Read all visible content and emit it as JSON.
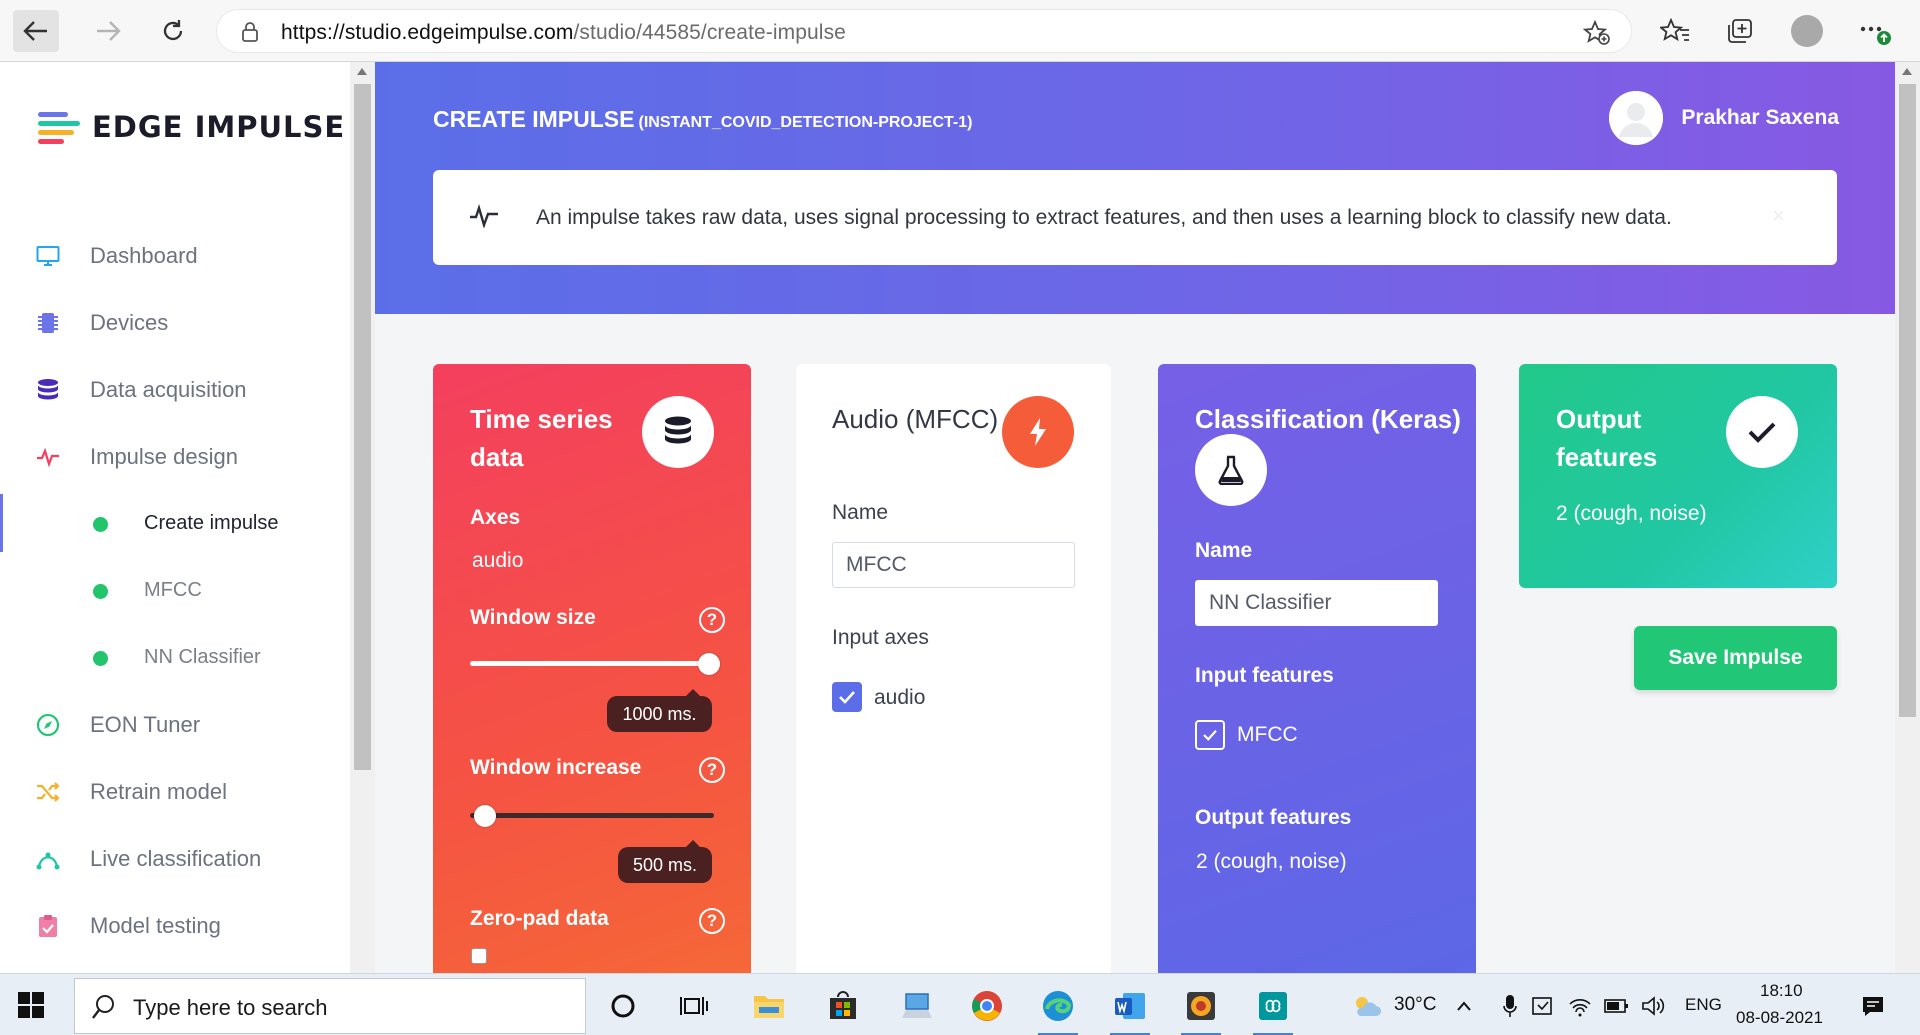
{
  "browser": {
    "url_domain": "https://studio.edgeimpulse.com",
    "url_path": "/studio/44585/create-impulse"
  },
  "sidebar": {
    "logo_text": "EDGE IMPULSE",
    "items": [
      {
        "label": "Dashboard",
        "icon": "monitor-icon"
      },
      {
        "label": "Devices",
        "icon": "chip-icon"
      },
      {
        "label": "Data acquisition",
        "icon": "database-icon"
      },
      {
        "label": "Impulse design",
        "icon": "pulse-icon"
      },
      {
        "label": "Create impulse",
        "icon": "dot"
      },
      {
        "label": "MFCC",
        "icon": "dot"
      },
      {
        "label": "NN Classifier",
        "icon": "dot"
      },
      {
        "label": "EON Tuner",
        "icon": "compass-icon"
      },
      {
        "label": "Retrain model",
        "icon": "shuffle-icon"
      },
      {
        "label": "Live classification",
        "icon": "curve-icon"
      },
      {
        "label": "Model testing",
        "icon": "clipboard-icon"
      }
    ]
  },
  "header": {
    "title": "CREATE IMPULSE",
    "subtitle": "(INSTANT_COVID_DETECTION-PROJECT-1)",
    "user_name": "Prakhar Saxena",
    "info_text": "An impulse takes raw data, uses signal processing to extract features, and then uses a learning block to classify new data.",
    "info_close": "×"
  },
  "cards": {
    "time_series": {
      "title_line1": "Time series",
      "title_line2": "data",
      "axes_label": "Axes",
      "axes_value": "audio",
      "window_size_label": "Window size",
      "window_size_value": "1000 ms.",
      "window_size_fraction": 1.0,
      "window_increase_label": "Window increase",
      "window_increase_value": "500 ms.",
      "window_increase_fraction": 0.06,
      "zero_pad_label": "Zero-pad data",
      "help_glyph": "?"
    },
    "mfcc": {
      "title": "Audio (MFCC)",
      "name_label": "Name",
      "name_value": "MFCC",
      "input_axes_label": "Input axes",
      "axis_item": "audio"
    },
    "classifier": {
      "title": "Classification (Keras)",
      "name_label": "Name",
      "name_value": "NN Classifier",
      "input_features_label": "Input features",
      "input_feature_item": "MFCC",
      "output_features_label": "Output features",
      "output_features_value": "2 (cough, noise)"
    },
    "output": {
      "title_line1": "Output",
      "title_line2": "features",
      "value": "2 (cough, noise)"
    }
  },
  "save_button": "Save Impulse",
  "taskbar": {
    "search_placeholder": "Type here to search",
    "weather": "30°C",
    "language": "ENG",
    "time": "18:10",
    "date": "08-08-2021"
  },
  "colors": {
    "hero_start": "#5b6ee8",
    "hero_end": "#8759e3",
    "time_series_card": "#f43f5e",
    "mfcc_accent": "#f55c3a",
    "classifier_card": "#6a63e6",
    "output_card": "#22c989",
    "save_button": "#21c776",
    "active_dot": "#23c56c"
  }
}
